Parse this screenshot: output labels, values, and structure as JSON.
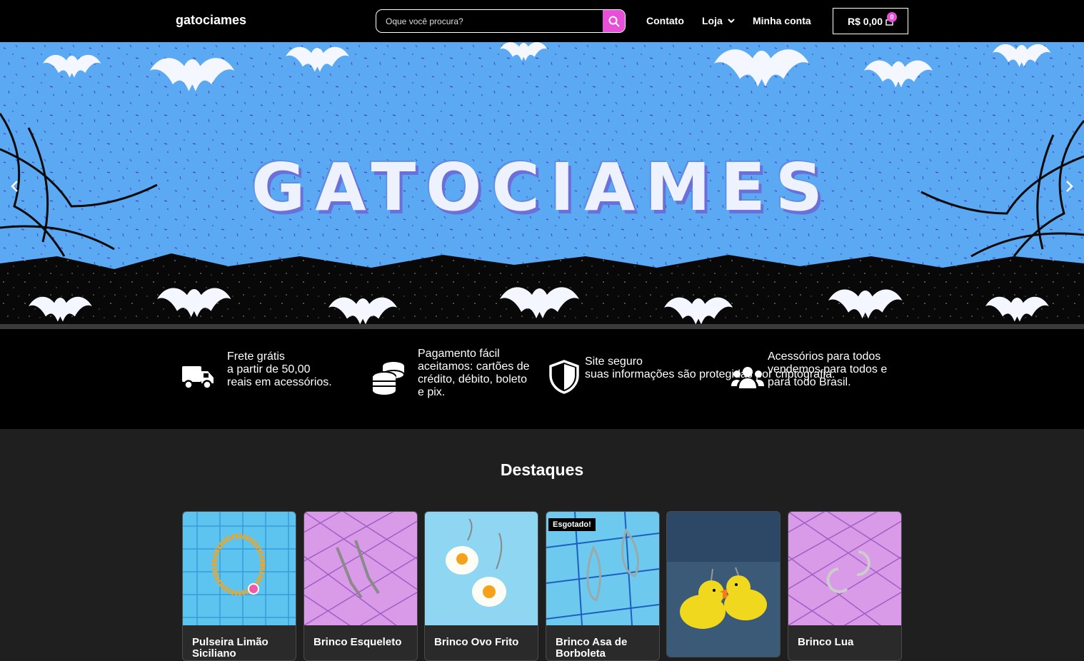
{
  "header": {
    "logo": "gatociames",
    "search_placeholder": "Oque você procura?",
    "nav": {
      "contato": "Contato",
      "loja": "Loja",
      "minha_conta": "Minha conta"
    },
    "cart": {
      "total": "R$ 0,00",
      "count": "0"
    }
  },
  "hero": {
    "title": "GATOCIAMES"
  },
  "features": [
    {
      "title": "Frete grátis",
      "text": "a partir de 50,00 reais em acessórios.",
      "icon": "truck-icon"
    },
    {
      "title": "Pagamento fácil",
      "text": "aceitamos: cartões de crédito, débito, boleto e pix.",
      "icon": "coins-icon"
    },
    {
      "title": "Site seguro",
      "text": "suas informações são protegidas por criptografia.",
      "icon": "shield-icon"
    },
    {
      "title": "Acessórios para todos",
      "text": "vendemos para todos e para todo Brasil.",
      "icon": "users-icon"
    }
  ],
  "destaques": {
    "title": "Destaques",
    "products": [
      {
        "name": "Pulseira Limão Siciliano",
        "badge": ""
      },
      {
        "name": "Brinco Esqueleto",
        "badge": ""
      },
      {
        "name": "Brinco Ovo Frito",
        "badge": ""
      },
      {
        "name": "Brinco Asa de Borboleta",
        "badge": "Esgotado!"
      },
      {
        "name": "",
        "badge": ""
      },
      {
        "name": "Brinco Lua",
        "badge": ""
      }
    ]
  },
  "colors": {
    "accent": "#e84fd8",
    "hero_bg": "#5aa9f2",
    "page_bg": "#1f1f1f"
  }
}
